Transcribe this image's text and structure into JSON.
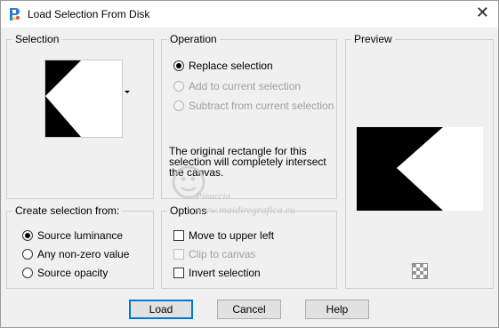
{
  "window": {
    "title": "Load Selection From Disk",
    "close_glyph": "✕"
  },
  "selection": {
    "label": "Selection"
  },
  "operation": {
    "label": "Operation",
    "options": [
      {
        "label": "Replace selection",
        "selected": true,
        "enabled": true
      },
      {
        "label": "Add to current selection",
        "selected": false,
        "enabled": false
      },
      {
        "label": "Subtract from current selection",
        "selected": false,
        "enabled": false
      }
    ],
    "info_text": "The original rectangle for this selection will completely intersect the canvas."
  },
  "preview": {
    "label": "Preview",
    "transparency_icon": "checkerboard-icon"
  },
  "create_from": {
    "label": "Create selection from:",
    "options": [
      {
        "label": "Source luminance",
        "selected": true
      },
      {
        "label": "Any non-zero value",
        "selected": false
      },
      {
        "label": "Source opacity",
        "selected": false
      }
    ]
  },
  "options": {
    "label": "Options",
    "items": [
      {
        "label": "Move to upper left",
        "checked": false,
        "enabled": true
      },
      {
        "label": "Clip to canvas",
        "checked": false,
        "enabled": false
      },
      {
        "label": "Invert selection",
        "checked": false,
        "enabled": true
      }
    ]
  },
  "buttons": {
    "load": "Load",
    "cancel": "Cancel",
    "help": "Help"
  },
  "watermark": {
    "text": "Pinuccia",
    "url": "www.maidiregrafica.eu"
  },
  "colors": {
    "accent": "#0078d7",
    "title_bg": "#ffffff",
    "dialog_bg": "#f0f0f0"
  }
}
